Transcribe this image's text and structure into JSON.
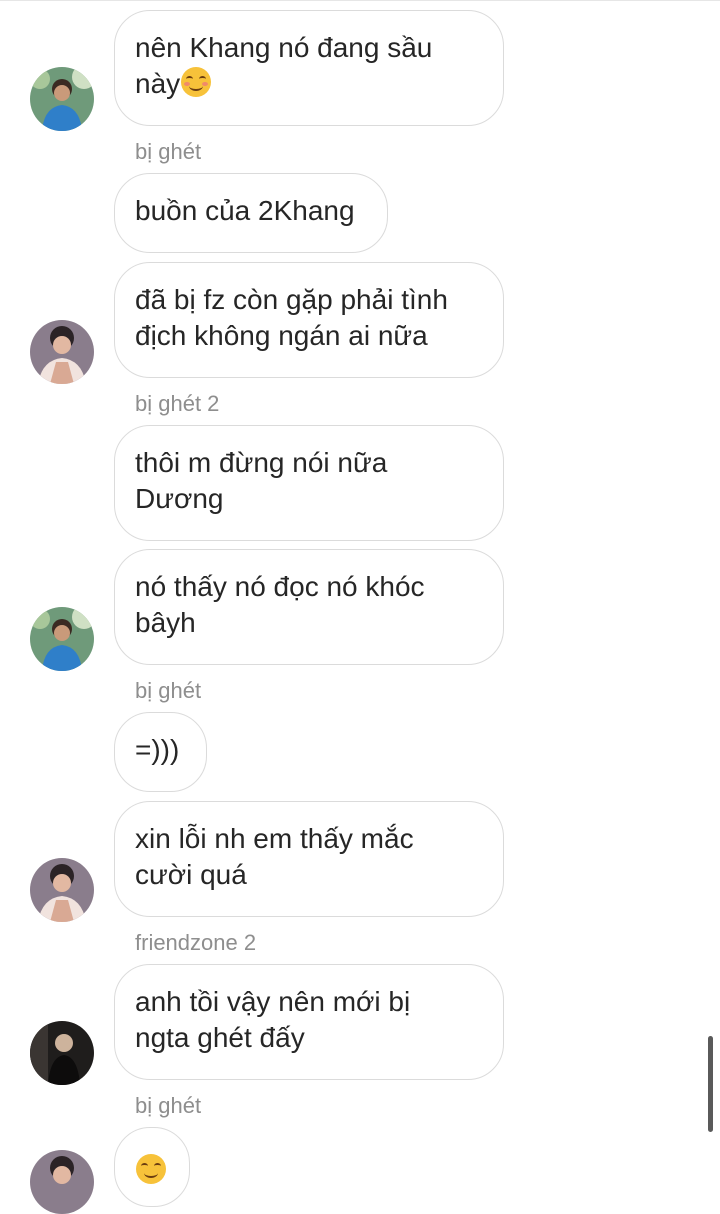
{
  "messages": [
    {
      "lines": [
        "nên Khang nó đang sầu",
        "này"
      ],
      "emoji": "smiling-face-icon"
    },
    {
      "lines": [
        "buồn của 2Khang"
      ]
    },
    {
      "lines": [
        "đã bị fz còn gặp phải tình",
        "địch không ngán ai nữa"
      ]
    },
    {
      "lines": [
        "thôi m đừng nói nữa",
        "Dương"
      ]
    },
    {
      "lines": [
        "nó thấy nó đọc nó khóc",
        "bâyh"
      ]
    },
    {
      "lines": [
        "=)))"
      ]
    },
    {
      "lines": [
        "xin lỗi nh em thấy mắc",
        "cười quá"
      ]
    },
    {
      "lines": [
        "anh tồi vậy nên mới bị",
        "ngta ghét đấy"
      ]
    }
  ],
  "senders": [
    "bị ghét",
    "bị ghét 2",
    "bị ghét",
    "friendzone 2",
    "bị ghét"
  ],
  "colors": {
    "bubble_border": "#dbdbdb",
    "text": "#262626",
    "sender_name": "#8e8e8e",
    "background": "#ffffff"
  }
}
